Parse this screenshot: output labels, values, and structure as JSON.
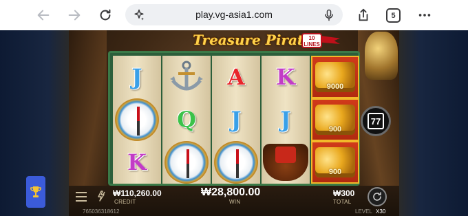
{
  "browser": {
    "url": "play.vg-asia1.com",
    "tab_count": "5"
  },
  "game": {
    "logo_text": "Treasure Pirate",
    "lines_badge": [
      "10",
      "LINES"
    ],
    "free_spins": "77",
    "reels": [
      [
        {
          "type": "letter",
          "text": "J",
          "color": "#3aa0e8"
        },
        {
          "type": "compass"
        },
        {
          "type": "letter",
          "text": "K",
          "color": "#c23cc6"
        }
      ],
      [
        {
          "type": "anchor"
        },
        {
          "type": "letter",
          "text": "Q",
          "color": "#3cc24a"
        },
        {
          "type": "compass"
        }
      ],
      [
        {
          "type": "letter",
          "text": "A",
          "color": "#e8262a"
        },
        {
          "type": "letter",
          "text": "J",
          "color": "#3aa0e8"
        },
        {
          "type": "compass"
        }
      ],
      [
        {
          "type": "letter",
          "text": "K",
          "color": "#c23cc6"
        },
        {
          "type": "letter",
          "text": "J",
          "color": "#3aa0e8"
        },
        {
          "type": "ship"
        }
      ],
      [
        {
          "type": "coins",
          "value": "9000"
        },
        {
          "type": "coins",
          "value": "900"
        },
        {
          "type": "coins",
          "value": "900"
        }
      ]
    ]
  },
  "bottom_bar": {
    "credit_value": "₩110,260.00",
    "credit_label": "CREDIT",
    "win_value": "₩28,800.00",
    "win_label": "WIN",
    "total_value": "₩300",
    "total_label": "TOTAL",
    "game_id": "765036318612",
    "level_label": "LEVEL",
    "level_value": "X30"
  }
}
